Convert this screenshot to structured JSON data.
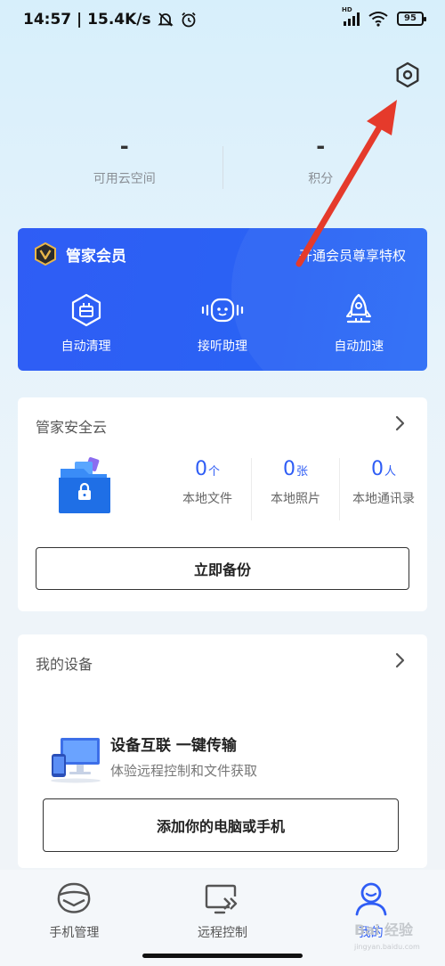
{
  "status_bar": {
    "time_speed": "14:57 | 15.4K/s",
    "battery": "95",
    "hd_label": "HD"
  },
  "top_stats": [
    {
      "value": "-",
      "label": "可用云空间"
    },
    {
      "value": "-",
      "label": "积分"
    }
  ],
  "member": {
    "title": "管家会员",
    "promo": "开通会员尊享特权",
    "features": [
      {
        "label": "自动清理",
        "icon": "broom-box-icon"
      },
      {
        "label": "接听助理",
        "icon": "robot-icon"
      },
      {
        "label": "自动加速",
        "icon": "rocket-icon"
      }
    ]
  },
  "cloud": {
    "title": "管家安全云",
    "stats": [
      {
        "num": "0",
        "unit": "个",
        "label": "本地文件"
      },
      {
        "num": "0",
        "unit": "张",
        "label": "本地照片"
      },
      {
        "num": "0",
        "unit": "人",
        "label": "本地通讯录"
      }
    ],
    "backup_label": "立即备份"
  },
  "devices": {
    "title": "我的设备",
    "headline": "设备互联 一键传输",
    "subtitle": "体验远程控制和文件获取",
    "add_label": "添加你的电脑或手机"
  },
  "nav": [
    {
      "label": "手机管理",
      "icon": "phone-manage-icon",
      "active": false
    },
    {
      "label": "远程控制",
      "icon": "remote-control-icon",
      "active": false
    },
    {
      "label": "我的",
      "icon": "profile-icon",
      "active": true
    }
  ],
  "watermark": {
    "text": "Bai 经验",
    "sub": "jingyan.baidu.com"
  },
  "colors": {
    "accent": "#2f5df5",
    "arrow": "#e53a2b"
  }
}
